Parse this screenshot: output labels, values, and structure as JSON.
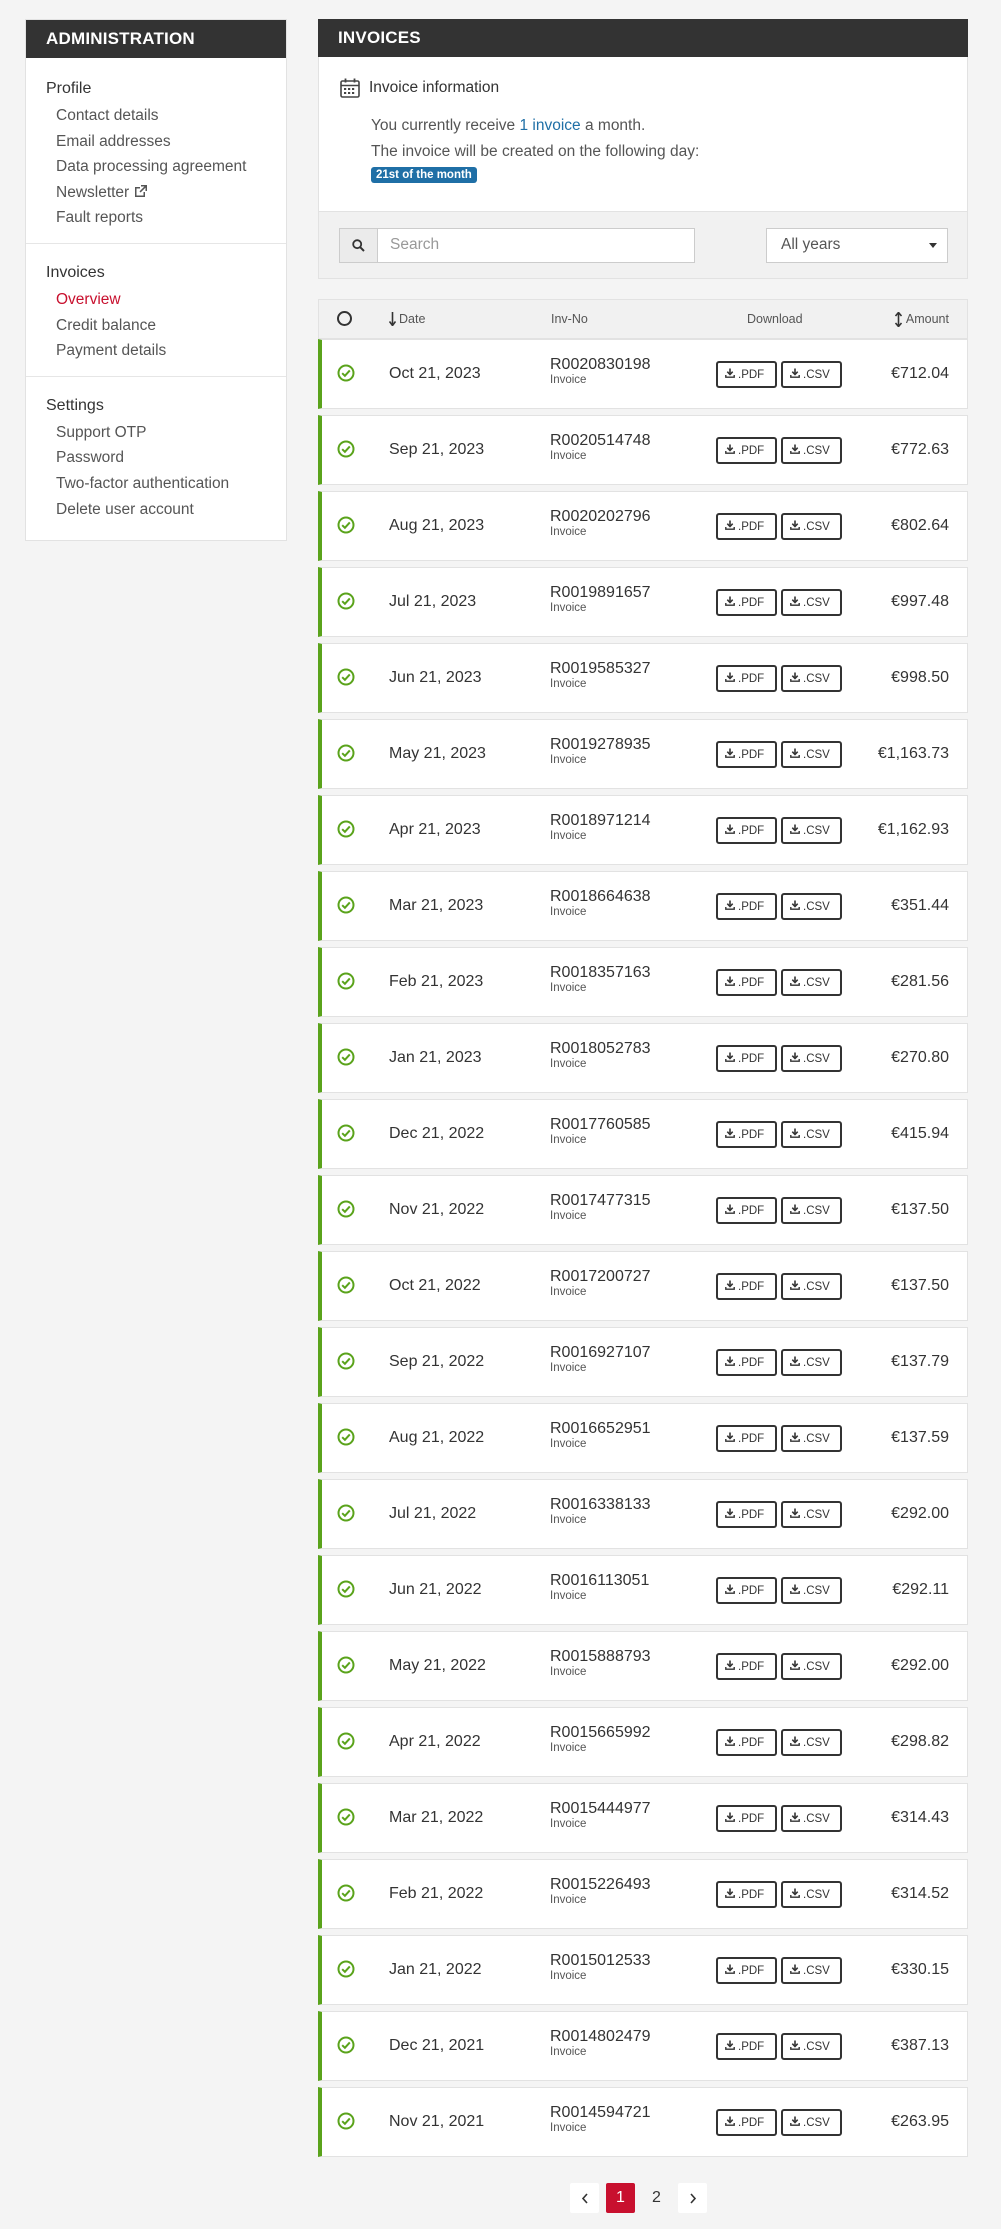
{
  "sidebar": {
    "header": "ADMINISTRATION",
    "groups": [
      {
        "title": "Profile",
        "items": [
          {
            "label": "Contact details"
          },
          {
            "label": "Email addresses"
          },
          {
            "label": "Data processing agreement"
          },
          {
            "label": "Newsletter"
          },
          {
            "label": "Fault reports"
          }
        ]
      },
      {
        "title": "Invoices",
        "items": [
          {
            "label": "Overview",
            "active": true
          },
          {
            "label": "Credit balance"
          },
          {
            "label": "Payment details"
          }
        ]
      },
      {
        "title": "Settings",
        "items": [
          {
            "label": "Support OTP"
          },
          {
            "label": "Password"
          },
          {
            "label": "Two-factor authentication"
          },
          {
            "label": "Delete user account"
          }
        ]
      }
    ]
  },
  "main": {
    "header": "INVOICES",
    "info": {
      "title": "Invoice information",
      "line1_prefix": "You currently receive ",
      "line1_link": "1 invoice",
      "line1_suffix": " a month.",
      "line2": "The invoice will be created on the following day:",
      "badge": "21st of the month"
    },
    "filters": {
      "search_placeholder": "Search",
      "year_select": "All years"
    },
    "table": {
      "columns": {
        "date": "Date",
        "invno": "Inv-No",
        "download": "Download",
        "amount": "Amount"
      },
      "pdf_label": ".PDF",
      "csv_label": ".CSV",
      "rows": [
        {
          "date": "Oct 21, 2023",
          "invno": "R0020830198",
          "type": "Invoice",
          "amount": "€712.04"
        },
        {
          "date": "Sep 21, 2023",
          "invno": "R0020514748",
          "type": "Invoice",
          "amount": "€772.63"
        },
        {
          "date": "Aug 21, 2023",
          "invno": "R0020202796",
          "type": "Invoice",
          "amount": "€802.64"
        },
        {
          "date": "Jul 21, 2023",
          "invno": "R0019891657",
          "type": "Invoice",
          "amount": "€997.48"
        },
        {
          "date": "Jun 21, 2023",
          "invno": "R0019585327",
          "type": "Invoice",
          "amount": "€998.50"
        },
        {
          "date": "May 21, 2023",
          "invno": "R0019278935",
          "type": "Invoice",
          "amount": "€1,163.73"
        },
        {
          "date": "Apr 21, 2023",
          "invno": "R0018971214",
          "type": "Invoice",
          "amount": "€1,162.93"
        },
        {
          "date": "Mar 21, 2023",
          "invno": "R0018664638",
          "type": "Invoice",
          "amount": "€351.44"
        },
        {
          "date": "Feb 21, 2023",
          "invno": "R0018357163",
          "type": "Invoice",
          "amount": "€281.56"
        },
        {
          "date": "Jan 21, 2023",
          "invno": "R0018052783",
          "type": "Invoice",
          "amount": "€270.80"
        },
        {
          "date": "Dec 21, 2022",
          "invno": "R0017760585",
          "type": "Invoice",
          "amount": "€415.94"
        },
        {
          "date": "Nov 21, 2022",
          "invno": "R0017477315",
          "type": "Invoice",
          "amount": "€137.50"
        },
        {
          "date": "Oct 21, 2022",
          "invno": "R0017200727",
          "type": "Invoice",
          "amount": "€137.50"
        },
        {
          "date": "Sep 21, 2022",
          "invno": "R0016927107",
          "type": "Invoice",
          "amount": "€137.79"
        },
        {
          "date": "Aug 21, 2022",
          "invno": "R0016652951",
          "type": "Invoice",
          "amount": "€137.59"
        },
        {
          "date": "Jul 21, 2022",
          "invno": "R0016338133",
          "type": "Invoice",
          "amount": "€292.00"
        },
        {
          "date": "Jun 21, 2022",
          "invno": "R0016113051",
          "type": "Invoice",
          "amount": "€292.11"
        },
        {
          "date": "May 21, 2022",
          "invno": "R0015888793",
          "type": "Invoice",
          "amount": "€292.00"
        },
        {
          "date": "Apr 21, 2022",
          "invno": "R0015665992",
          "type": "Invoice",
          "amount": "€298.82"
        },
        {
          "date": "Mar 21, 2022",
          "invno": "R0015444977",
          "type": "Invoice",
          "amount": "€314.43"
        },
        {
          "date": "Feb 21, 2022",
          "invno": "R0015226493",
          "type": "Invoice",
          "amount": "€314.52"
        },
        {
          "date": "Jan 21, 2022",
          "invno": "R0015012533",
          "type": "Invoice",
          "amount": "€330.15"
        },
        {
          "date": "Dec 21, 2021",
          "invno": "R0014802479",
          "type": "Invoice",
          "amount": "€387.13"
        },
        {
          "date": "Nov 21, 2021",
          "invno": "R0014594721",
          "type": "Invoice",
          "amount": "€263.95"
        }
      ]
    },
    "pagination": {
      "pages": [
        "1",
        "2"
      ],
      "current": "1"
    }
  },
  "colors": {
    "accent_red": "#c8102e",
    "link_blue": "#1f6fa6",
    "paid_green": "#5aa31b",
    "header_dark": "#333333"
  }
}
